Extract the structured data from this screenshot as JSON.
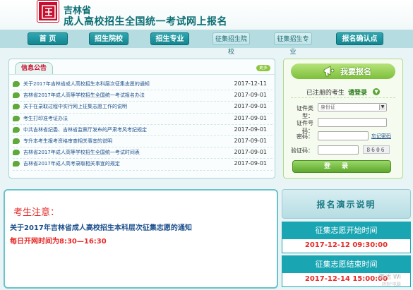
{
  "header": {
    "province": "吉林省",
    "title": "成人高校招生全国统一考试网上报名",
    "logo_icon": "school-seal-icon"
  },
  "nav": {
    "items": [
      {
        "label": "首  页",
        "style": "dark"
      },
      {
        "label": "招生院校",
        "style": "dark"
      },
      {
        "label": "招生专业",
        "style": "dark"
      },
      {
        "label": "征集招生院校",
        "style": "light"
      },
      {
        "label": "征集招生专业",
        "style": "light"
      },
      {
        "label": "报名确认点",
        "style": "dark"
      }
    ]
  },
  "info": {
    "tab_label": "信息公告",
    "more_label": "更多",
    "items": [
      {
        "title": "关于2017年吉林省成人高校招生本科层次征集志愿的通知",
        "date": "2017-12-11"
      },
      {
        "title": "吉林省2017年成人高等学校招生全国统一考试报名办法",
        "date": "2017-09-01"
      },
      {
        "title": "关于在录取过程中实行网上征集志愿工作的说明",
        "date": "2017-09-01"
      },
      {
        "title": "考生打印准考证办法",
        "date": "2017-09-01"
      },
      {
        "title": "中共吉林省纪委、吉林省监察厅发布的严肃考风考纪规定",
        "date": "2017-09-01"
      },
      {
        "title": "专升本考生报考资格审查相关事宜的说明",
        "date": "2017-09-01"
      },
      {
        "title": "吉林省2017年成人高等学校招生全国统一考试时间表",
        "date": "2017-09-01"
      },
      {
        "title": "吉林省2017年成人高考录取相关事宜的规定",
        "date": "2017-09-01"
      }
    ]
  },
  "register": {
    "banner": "我要报名",
    "login_prompt": "已注册的考生",
    "login_link": "请登录",
    "labels": {
      "id_type": "证件类型：",
      "id_number": "证件号码：",
      "password": "密码：",
      "captcha": "验证码："
    },
    "id_type_value": "身份证",
    "forgot_password": "忘记密码",
    "captcha_value": "8606",
    "login_button": "登录"
  },
  "notice": {
    "title": "考生注意：",
    "line1": "关于2017年吉林省成人高校招生本科层次征集志愿的通知",
    "line2": "每日开网时间为8:30—16:30"
  },
  "demo": {
    "label": "报名演示说明"
  },
  "times": [
    {
      "label": "征集志愿开始时间",
      "value": "2017-12-12 09:30:00"
    },
    {
      "label": "征集志愿结束时间",
      "value": "2017-12-14 15:00:00"
    }
  ],
  "watermark": {
    "line1": "激活 Wi",
    "line2": "转到\"电脑"
  }
}
